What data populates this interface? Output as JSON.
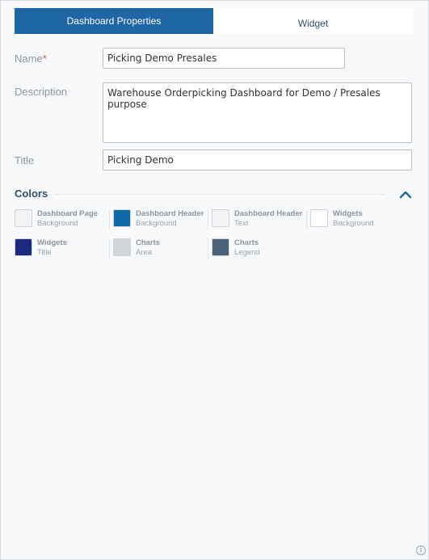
{
  "tabs": [
    {
      "label": "Dashboard Properties",
      "active": true
    },
    {
      "label": "Widget",
      "active": false
    }
  ],
  "form": {
    "name_label": "Name",
    "name_required_mark": "*",
    "name_value": "Picking Demo Presales",
    "description_label": "Description",
    "description_value": "Warehouse Orderpicking Dashboard for Demo / Presales purpose",
    "title_label": "Title",
    "title_value": "Picking Demo"
  },
  "colors": {
    "section_title": "Colors",
    "collapse_icon": "chevron-up-icon",
    "items": [
      {
        "line1": "Dashboard Page",
        "line2": "Background",
        "color": "#f2f3f5"
      },
      {
        "line1": "Dashboard Header",
        "line2": "Background",
        "color": "#0e6aa6"
      },
      {
        "line1": "Dashboard Header",
        "line2": "Text",
        "color": "#f2f3f5"
      },
      {
        "line1": "Widgets",
        "line2": "Background",
        "color": "#ffffff"
      },
      {
        "line1": "Widgets",
        "line2": "Title",
        "color": "#1c2a7d"
      },
      {
        "line1": "Charts",
        "line2": "Area",
        "color": "#d3d7dc"
      },
      {
        "line1": "Charts",
        "line2": "Legend",
        "color": "#4a6178"
      }
    ]
  },
  "footer": {
    "info_icon": "info-icon",
    "info_glyph": "i"
  }
}
